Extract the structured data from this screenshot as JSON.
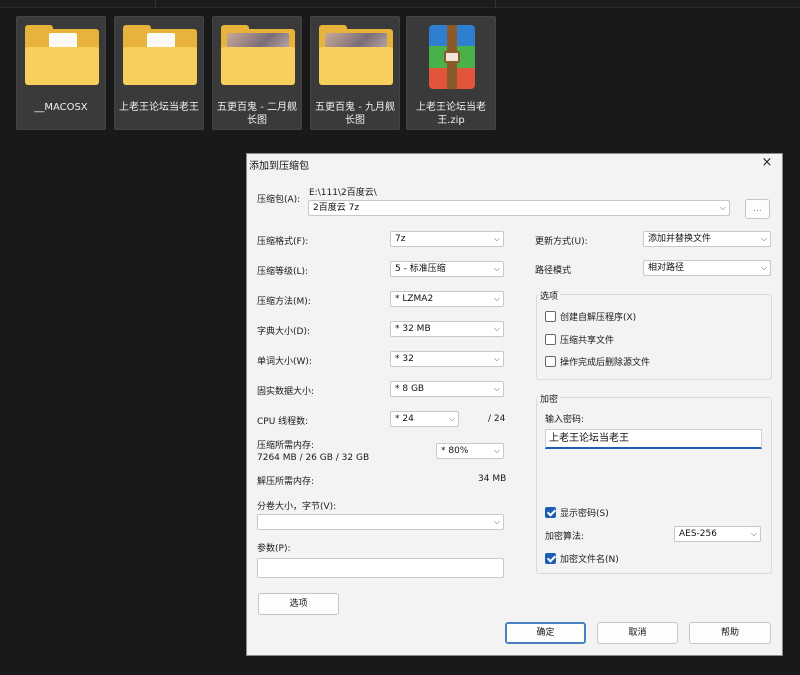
{
  "explorer": {
    "files": [
      {
        "name": "__MACOSX",
        "type": "folder-doc"
      },
      {
        "name": "上老王论坛当老王",
        "type": "folder-doc"
      },
      {
        "name": "五更百鬼 - 二月舰长图",
        "type": "folder-photo"
      },
      {
        "name": "五更百鬼 - 九月舰长图",
        "type": "folder-photo"
      },
      {
        "name": "上老王论坛当老王.zip",
        "type": "zip-archive"
      }
    ]
  },
  "dialog": {
    "title": "添加到压缩包",
    "close_icon": "×",
    "archive_label": "压缩包(A):",
    "archive_path": "E:\\111\\2百度云\\",
    "archive_name": "2百度云 7z",
    "browse_label": "...",
    "format_label": "压缩格式(F):",
    "format_value": "7z",
    "level_label": "压缩等级(L):",
    "level_value": "5 - 标准压缩",
    "method_label": "压缩方法(M):",
    "method_value": "*  LZMA2",
    "dict_label": "字典大小(D):",
    "dict_value": "*  32 MB",
    "word_label": "单词大小(W):",
    "word_value": "*  32",
    "solid_label": "固实数据大小:",
    "solid_value": "*  8 GB",
    "cpu_label": "CPU 线程数:",
    "cpu_value": "*  24",
    "cpu_total": "/ 24",
    "mem_comp_label": "压缩所需内存:",
    "mem_comp_detail": "7264 MB / 26 GB / 32 GB",
    "mem_comp_value": "*  80%",
    "mem_decomp_label": "解压所需内存:",
    "mem_decomp_value": "34 MB",
    "split_label": "分卷大小，字节(V):",
    "split_value": "",
    "params_label": "参数(P):",
    "params_value": "",
    "options_button": "选项",
    "update_label": "更新方式(U):",
    "update_value": "添加并替换文件",
    "path_label": "路径模式",
    "path_value": "相对路径",
    "options_group": {
      "title": "选项",
      "sfx": "创建自解压程序(X)",
      "shared": "压缩共享文件",
      "delete": "操作完成后删除源文件"
    },
    "encryption_group": {
      "title": "加密",
      "password_label": "输入密码:",
      "password_value": "上老王论坛当老王",
      "show_password": "显示密码(S)",
      "method_label": "加密算法:",
      "method_value": "AES-256",
      "encrypt_names": "加密文件名(N)"
    },
    "ok_button": "确定",
    "cancel_button": "取消",
    "help_button": "帮助",
    "dropdown_arrow": "⌵"
  }
}
